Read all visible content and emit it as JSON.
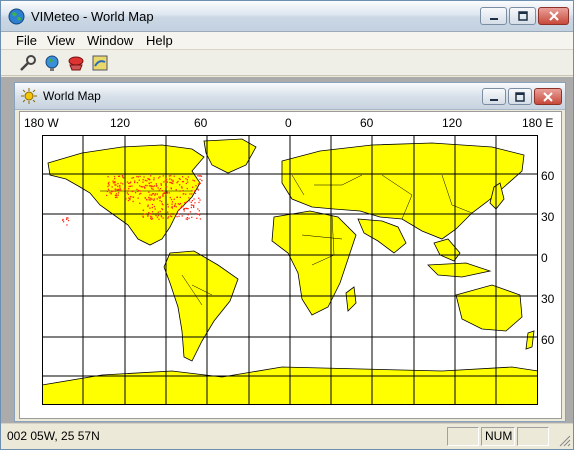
{
  "window": {
    "title": "VIMeteo - World Map",
    "controls": [
      "minimize",
      "maximize",
      "close"
    ]
  },
  "menu": {
    "items": [
      "File",
      "View",
      "Window",
      "Help"
    ]
  },
  "toolbar": {
    "buttons": [
      "search-tool-icon",
      "globe-icon",
      "weather-icon",
      "map-view-icon"
    ]
  },
  "child_window": {
    "title": "World Map"
  },
  "map": {
    "top_labels": [
      "180 W",
      "120",
      "60",
      "0",
      "60",
      "120",
      "180 E"
    ],
    "right_labels": [
      "60",
      "30",
      "0",
      "30",
      "60"
    ],
    "land_color": "#ffff00",
    "grid_color": "#000000",
    "observation_color": "#ff2a1a"
  },
  "status": {
    "coords": "002 05W,  25 57N",
    "num": "NUM"
  }
}
